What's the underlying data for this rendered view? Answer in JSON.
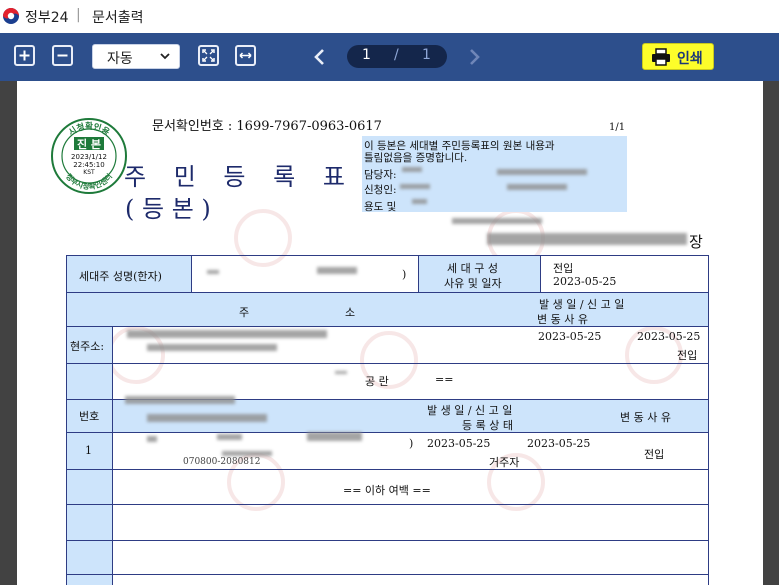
{
  "window": {
    "app_name": "정부24",
    "separator": "|",
    "title": "문서출력"
  },
  "toolbar": {
    "zoom_in_icon": "plus-box-icon",
    "zoom_out_icon": "minus-box-icon",
    "zoom_value": "자동",
    "fit_page_icon": "fit-page-icon",
    "fit_width_icon": "fit-width-icon",
    "page_current": "1",
    "page_separator": "/",
    "page_total": "1",
    "print_label": "인쇄",
    "colors": {
      "toolbar": "#2d4f8c",
      "print_button": "#fdfd2a",
      "page_pill": "#14264b"
    }
  },
  "document": {
    "doc_number_label": "문서확인번호 : 1699-7967-0963-0617",
    "page_fraction": "1/1",
    "title": "주 민 등 록 표",
    "subtitle": "(  등    본  )",
    "seal": {
      "top_text": "시청확인용",
      "main": "진 본",
      "date": "2023/1/12",
      "time": "22:45:10",
      "zone": "KST",
      "bottom_text": "정부시청확인센터"
    },
    "certification": {
      "line1": "이 등본은 세대별 주민등록표의 원본 내용과",
      "line2": "틀림없음을 증명합니다.",
      "handler_label": "담당자:",
      "applicant_label": "신청인:",
      "purpose_label": "용도 및"
    },
    "issuer_suffix": "장",
    "table": {
      "householder_label": "세대주 성명(한자)",
      "paren_close": ")",
      "composition_label_1": "세 대 구 성",
      "composition_label_2": "사유 및 일자",
      "composition_reason": "전입",
      "composition_date": "2023-05-25",
      "address_header_left": "주",
      "address_header_right": "소",
      "date_header_1": "발 생 일   /   신 고 일",
      "date_header_2": "변      동      사      유",
      "current_address_label": "현주소:",
      "addr_occurred": "2023-05-25",
      "addr_reported": "2023-05-25",
      "addr_reason": "전입",
      "gongran": "공    란",
      "equals": "==",
      "member_no_label": "번호",
      "member_date_header_1": "발 생 일   /   신 고 일",
      "member_date_header_2": "등 록 상 태",
      "member_reason_header": "변 동 사 유",
      "member": {
        "no": "1",
        "occurred": "2023-05-25",
        "reported": "2023-05-25",
        "status": "거주자",
        "reason": "전입",
        "partial_id": "070800-2080812"
      },
      "blank_note": "== 이하 여백 =="
    }
  }
}
